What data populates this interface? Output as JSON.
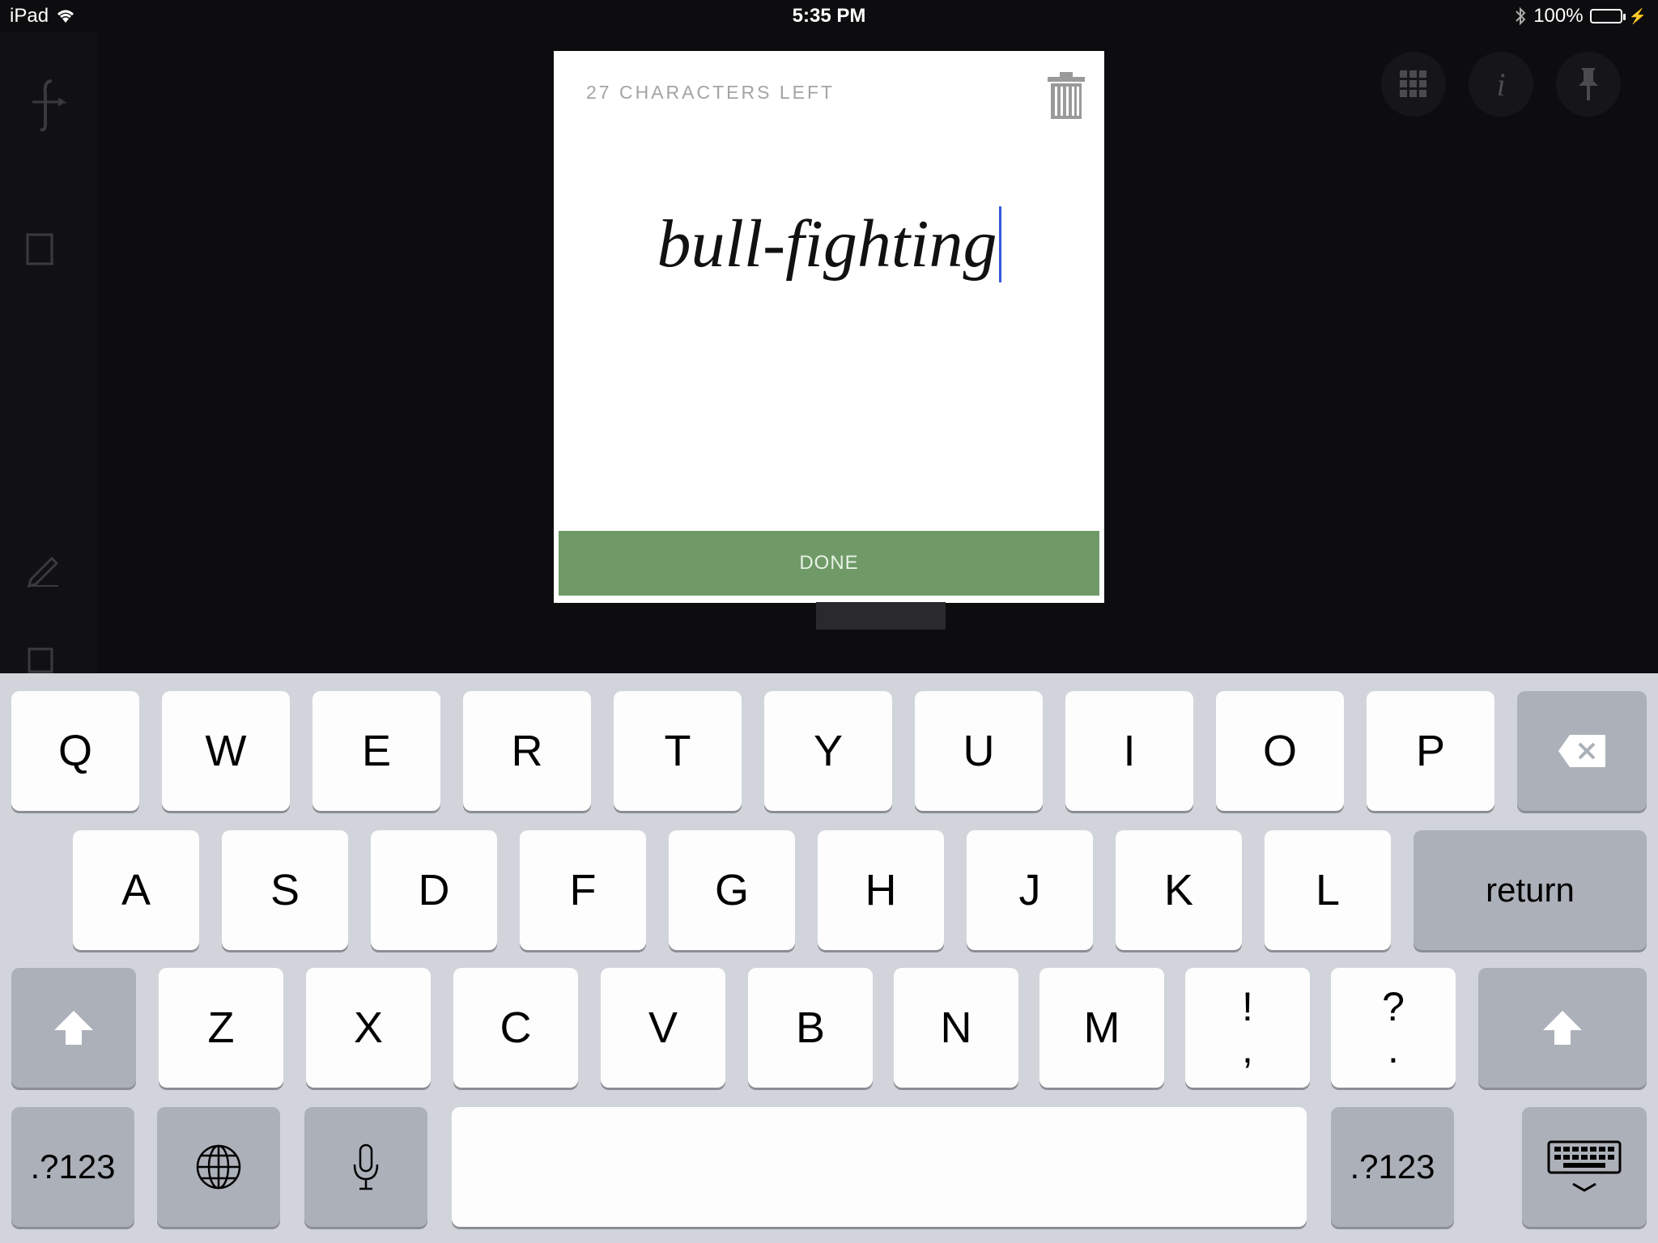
{
  "status_bar": {
    "device": "iPad",
    "time": "5:35 PM",
    "battery": "100%"
  },
  "card": {
    "chars_left": "27 CHARACTERS LEFT",
    "text": "bull-fighting",
    "done_label": "DONE"
  },
  "keyboard": {
    "row1": [
      "Q",
      "W",
      "E",
      "R",
      "T",
      "Y",
      "U",
      "I",
      "O",
      "P"
    ],
    "row2": [
      "A",
      "S",
      "D",
      "F",
      "G",
      "H",
      "J",
      "K",
      "L"
    ],
    "return_label": "return",
    "row3": [
      "Z",
      "X",
      "C",
      "V",
      "B",
      "N",
      "M"
    ],
    "punct1": [
      "!",
      ","
    ],
    "punct2": [
      "?",
      "."
    ],
    "num_label": ".?123",
    "space_label": ""
  },
  "icons": {
    "wifi": "wifi-icon",
    "bluetooth": "bluetooth-icon",
    "battery": "battery-icon",
    "trash": "trash-icon",
    "grid": "grid-icon",
    "info": "info-icon",
    "pin": "pin-icon"
  }
}
